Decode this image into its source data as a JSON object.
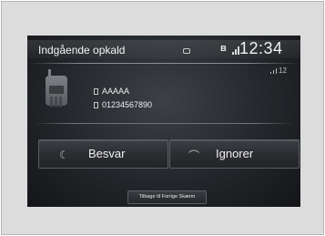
{
  "header": {
    "title": "Indgående opkald",
    "clock": "12:34",
    "bluetooth_icon": "bluetooth-icon",
    "signal_icon": "signal-icon",
    "record_icon": "record-icon"
  },
  "caller": {
    "name": "AAAAA",
    "number": "01234567890",
    "volume": "12",
    "phone_icon": "mobile-phone-icon"
  },
  "actions": {
    "answer_label": "Besvar",
    "ignore_label": "Ignorer"
  },
  "footer": {
    "back_label": "Tilbage til Forrige Skærm"
  },
  "colors": {
    "screen_bg": "#23262a",
    "text": "#f0f0f0",
    "frame_bg": "#dcdcdc"
  }
}
